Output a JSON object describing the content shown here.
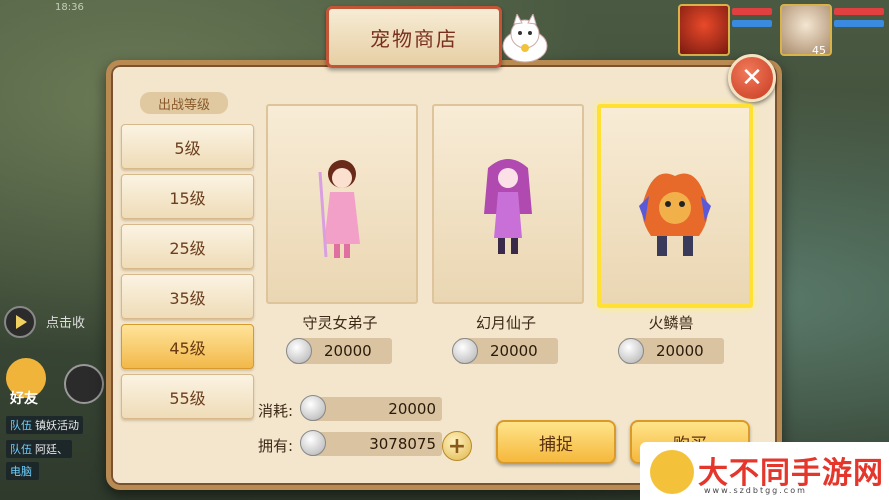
{
  "status_bar": {
    "time": "18:36"
  },
  "hud": {
    "auto_label": "点击收",
    "friends_label": "好友",
    "chips": [
      {
        "tag": "队伍",
        "text": "镇妖活动"
      },
      {
        "tag": "队伍",
        "text": "阿廷、"
      },
      {
        "tag": "电脑",
        "text": ""
      }
    ],
    "avatar_level": "45"
  },
  "shop": {
    "title": "宠物商店",
    "close_label": "✕",
    "level_title": "出战等级",
    "levels": [
      "5级",
      "15级",
      "25级",
      "35级",
      "45级",
      "55级"
    ],
    "active_level_index": 4,
    "pets": [
      {
        "name": "守灵女弟子",
        "price": "20000"
      },
      {
        "name": "幻月仙子",
        "price": "20000"
      },
      {
        "name": "火鳞兽",
        "price": "20000"
      }
    ],
    "selected_pet_index": 2,
    "cost_label": "消耗:",
    "cost_value": "20000",
    "owned_label": "拥有:",
    "owned_value": "3078075",
    "add_label": "+",
    "capture_label": "捕捉",
    "buy_label": "购买"
  },
  "watermark": {
    "text": "大不同手游网",
    "url": "www.szdbtgg.com"
  }
}
